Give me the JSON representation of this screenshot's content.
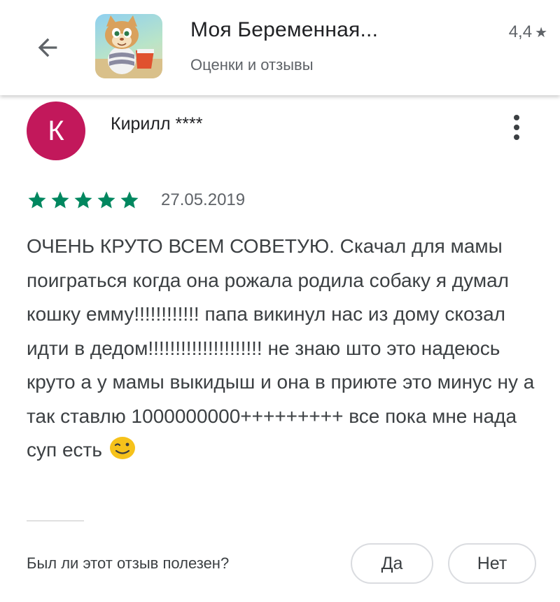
{
  "header": {
    "app_title": "Моя Беременная...",
    "subtitle": "Оценки и отзывы",
    "rating": "4,4",
    "rating_star": "★"
  },
  "review": {
    "avatar_letter": "К",
    "avatar_color": "#c2185b",
    "author": "Кирилл ****",
    "stars": 5,
    "star_color": "#01875f",
    "date": "27.05.2019",
    "text": "ОЧЕНЬ КРУТО ВСЕМ СОВЕТУЮ. Скачал для мамы поиграться когда она рожала родила собаку я думал кошку емму!!!!!!!!!!!! папа викинул нас из дому скозал идти в дедом!!!!!!!!!!!!!!!!!!!!! не знаю што это надеюсь круто а у мамы выкидыш и она в приюте это минус ну а так ставлю 1000000000+++++++++ все пока мне нада суп есть",
    "emoji": "smiley-wink-icon"
  },
  "helpful": {
    "question": "Был ли этот отзыв полезен?",
    "yes": "Да",
    "no": "Нет"
  }
}
